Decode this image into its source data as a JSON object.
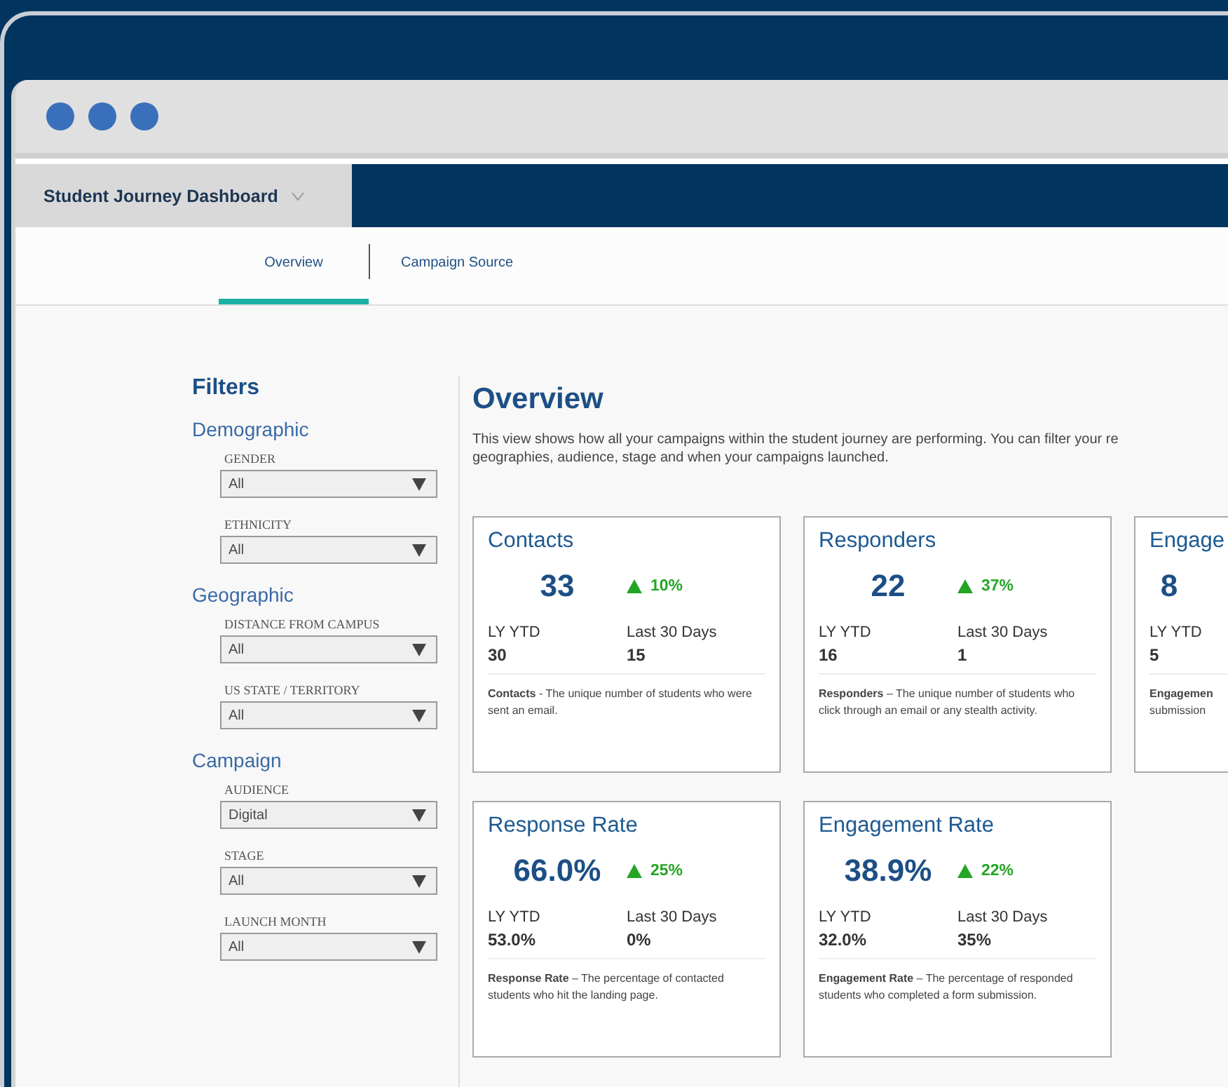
{
  "app_header": {
    "dashboard_selector": "Student Journey Dashboard"
  },
  "tabs": [
    {
      "label": "Overview",
      "selected": true
    },
    {
      "label": "Campaign Source",
      "selected": false
    }
  ],
  "filters": {
    "title": "Filters",
    "groups": [
      {
        "title": "Demographic",
        "fields": [
          {
            "label": "GENDER",
            "value": "All"
          },
          {
            "label": "ETHNICITY",
            "value": "All"
          }
        ]
      },
      {
        "title": "Geographic",
        "fields": [
          {
            "label": "DISTANCE FROM CAMPUS",
            "value": "All"
          },
          {
            "label": "US STATE / TERRITORY",
            "value": "All"
          }
        ]
      },
      {
        "title": "Campaign",
        "fields": [
          {
            "label": "AUDIENCE",
            "value": "Digital"
          },
          {
            "label": "STAGE",
            "value": "All"
          },
          {
            "label": "LAUNCH MONTH",
            "value": "All"
          }
        ]
      }
    ]
  },
  "overview": {
    "title": "Overview",
    "description": "This view shows how all your campaigns within the student journey are performing. You can filter your re\ngeographies, audience, stage and when your campaigns launched.",
    "cards": [
      {
        "title": "Contacts",
        "value": "33",
        "change": "10%",
        "ly_ytd_label": "LY YTD",
        "ly_ytd": "30",
        "last30_label": "Last 30 Days",
        "last30": "15",
        "description": "**Contacts** - The unique number of students who were sent an email."
      },
      {
        "title": "Responders",
        "value": "22",
        "change": "37%",
        "ly_ytd_label": "LY YTD",
        "ly_ytd": "16",
        "last30_label": "Last 30 Days",
        "last30": "1",
        "description": "**Responders** – The unique number of students who click through an email or any stealth activity."
      },
      {
        "title": "Engage",
        "value": "8",
        "ly_ytd_label": "LY YTD",
        "ly_ytd": "5",
        "description": "**Engagemen**\nsubmission"
      },
      {
        "title": "Response Rate",
        "value": "66.0%",
        "change": "25%",
        "ly_ytd_label": "LY YTD",
        "ly_ytd": "53.0%",
        "last30_label": "Last 30 Days",
        "last30": "0%",
        "description": "**Response Rate** – The percentage of contacted students who hit the landing page."
      },
      {
        "title": "Engagement Rate",
        "value": "38.9%",
        "change": "22%",
        "ly_ytd_label": "LY YTD",
        "ly_ytd": "32.0%",
        "last30_label": "Last 30 Days",
        "last30": "35%",
        "description": "**Engagement Rate** – The percentage of responded students who completed a form submission."
      }
    ]
  }
}
